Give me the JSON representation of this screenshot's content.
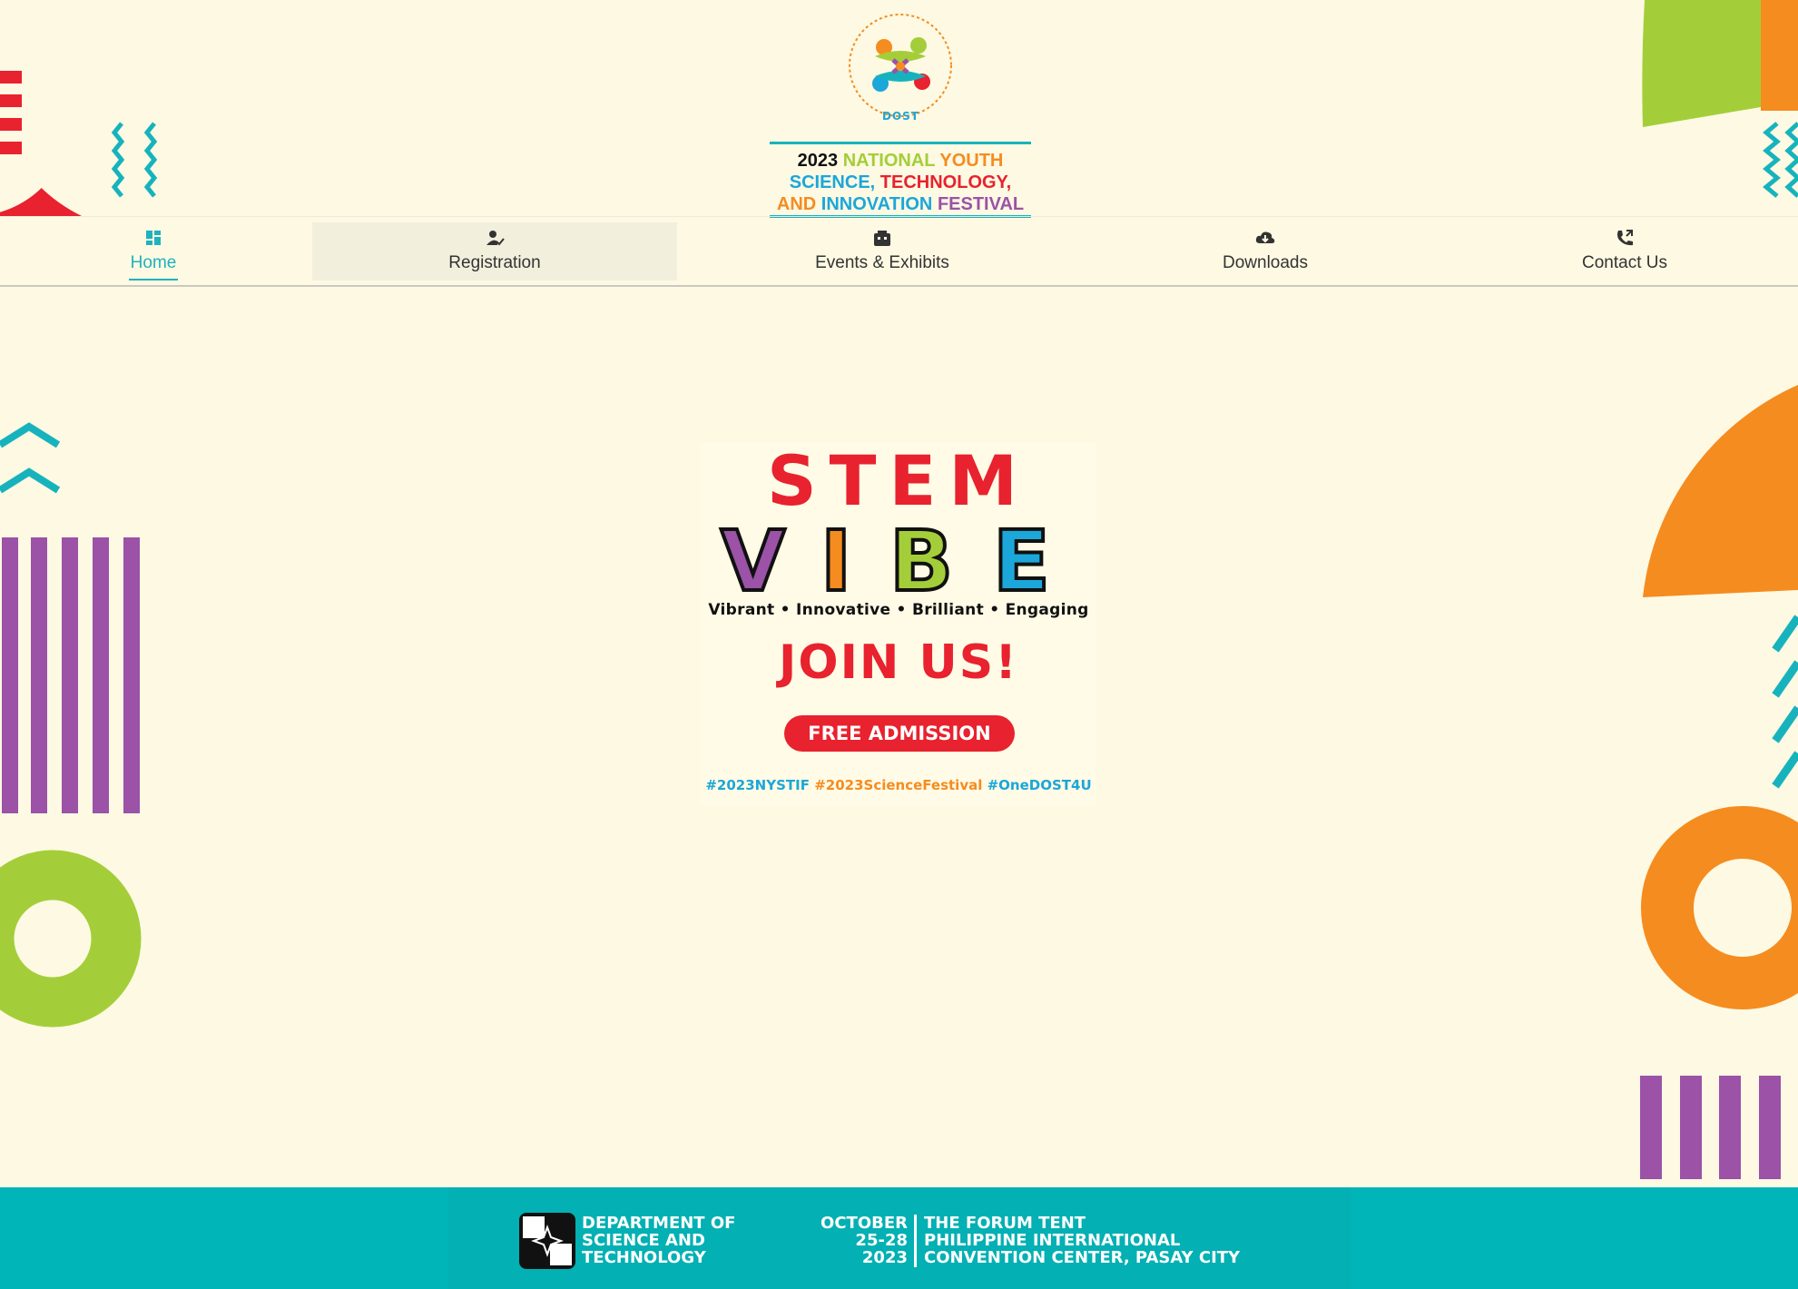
{
  "header": {
    "logo_title_line1": [
      "2023",
      "NATIONAL",
      "YOUTH"
    ],
    "logo_title_line2": [
      "SCIENCE,",
      "TECHNOLOGY,"
    ],
    "logo_title_line3": [
      "AND",
      "INNOVATION",
      "FESTIVAL"
    ],
    "emblem_label": "DOST"
  },
  "nav": {
    "items": [
      {
        "label": "Home",
        "icon": "dashboard-icon",
        "active": true
      },
      {
        "label": "Registration",
        "icon": "person-check-icon",
        "active": false
      },
      {
        "label": "Events & Exhibits",
        "icon": "theater-icon",
        "active": false
      },
      {
        "label": "Downloads",
        "icon": "cloud-download-icon",
        "active": false
      },
      {
        "label": "Contact Us",
        "icon": "phone-forward-icon",
        "active": false
      }
    ]
  },
  "poster": {
    "headline": "STEM",
    "vibe_letters": [
      "V",
      "I",
      "B",
      "E"
    ],
    "tagline": "Vibrant • Innovative • Brilliant • Engaging",
    "call_to_action": "JOIN US!",
    "badge": "FREE ADMISSION",
    "hashtags": [
      "#2023NYSTIF",
      "#2023ScienceFestival",
      "#OneDOST4U"
    ]
  },
  "footer": {
    "dept_lines": [
      "DEPARTMENT OF",
      "SCIENCE AND",
      "TECHNOLOGY"
    ],
    "date_lines": [
      "OCTOBER",
      "25-28",
      "2023"
    ],
    "venue_lines": [
      "THE FORUM TENT",
      "PHILIPPINE INTERNATIONAL",
      "CONVENTION CENTER, PASAY CITY"
    ]
  },
  "colors": {
    "background": "#fdf9e3",
    "teal": "#00b5b8",
    "red": "#e8222e",
    "orange": "#f58c1f",
    "green": "#a4ce39",
    "purple": "#9b52a7",
    "blue": "#1ba7d9"
  }
}
